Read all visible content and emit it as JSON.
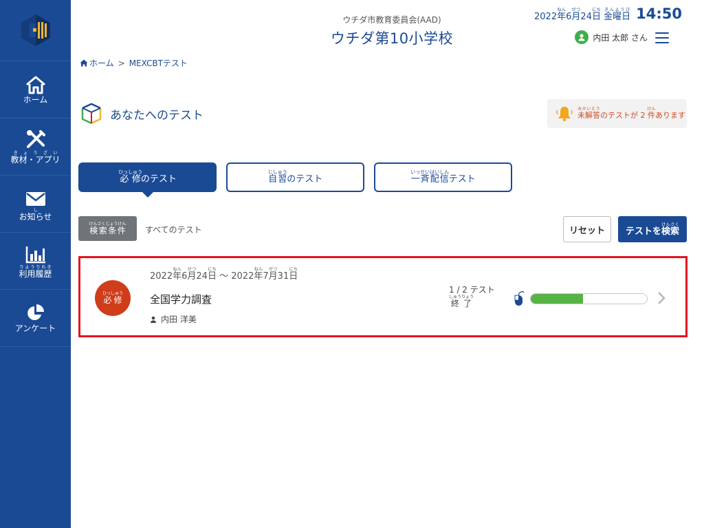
{
  "org_name": "ウチダ市教育委員会(AAD)",
  "school_name": "ウチダ第10小学校",
  "datetime": {
    "year": "2022",
    "month": "6",
    "day": "24",
    "weekday": "金曜日",
    "time": "14:50",
    "ruby": {
      "year": "ねん",
      "month": "がつ",
      "day": "にち",
      "weekday": "きんようび"
    }
  },
  "user": {
    "name": "内田 太郎 さん"
  },
  "sidebar": {
    "items": [
      {
        "label": "ホーム",
        "ruby": ""
      },
      {
        "label": "教材・アプリ",
        "ruby": "きょうざい"
      },
      {
        "label": "お知らせ",
        "ruby": "し"
      },
      {
        "label": "利用履歴",
        "ruby": "りようりれき"
      },
      {
        "label": "アンケート",
        "ruby": ""
      }
    ]
  },
  "breadcrumb": {
    "home": "ホーム",
    "separator": ">",
    "current": "MEXCBTテスト"
  },
  "section_title": "あなたへのテスト",
  "alert": {
    "word": "未解答",
    "word_ruby": "みかいとう",
    "text_mid": "のテストが 2",
    "unit": "件",
    "unit_ruby": "けん",
    "text_end": "あります"
  },
  "tabs": [
    {
      "label": "必修",
      "ruby": "ひっしゅう",
      "suffix": "のテスト",
      "active": true
    },
    {
      "label": "自習",
      "ruby": "じしゅう",
      "suffix": "のテスト",
      "active": false
    },
    {
      "label": "一斉配信",
      "ruby": "いっせいはいしん",
      "suffix": "テスト",
      "active": false
    }
  ],
  "filter": {
    "button_label": "検索条件",
    "button_ruby": "けんさくじょうけん",
    "value": "すべてのテスト"
  },
  "buttons": {
    "reset": "リセット",
    "search_prefix": "テストを",
    "search_kanji": "検索",
    "search_ruby": "けんさく"
  },
  "test_card": {
    "badge": "必修",
    "badge_ruby": "ひっしゅう",
    "start": {
      "year": "2022",
      "month": "6",
      "day": "24"
    },
    "end": {
      "year": "2022",
      "month": "7",
      "day": "31"
    },
    "range_separator": "～",
    "title": "全国学力調査",
    "assignee": "内田 洋美",
    "progress_count": "1 / 2 テスト",
    "status": "終了",
    "status_ruby": "しゅうりょう",
    "progress_percent": 45
  },
  "colors": {
    "primary": "#1a4a94",
    "alert": "#d04a20",
    "badge": "#cf3d1b",
    "progress": "#58b347",
    "highlight_border": "#e3141f"
  }
}
